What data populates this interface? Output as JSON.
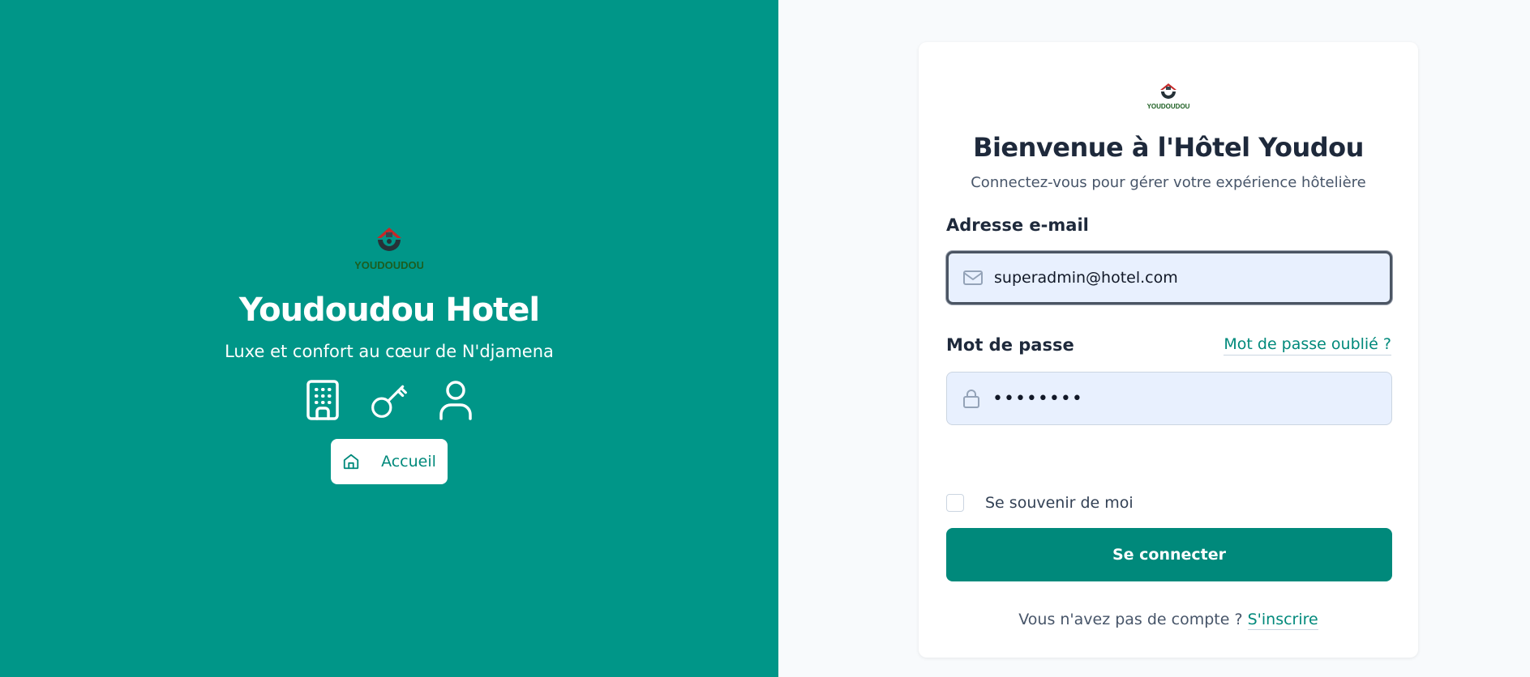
{
  "brand": {
    "logo_text": "YOUDOUDOU",
    "title": "Youdoudou Hotel",
    "tagline": "Luxe et confort au cœur de N'djamena",
    "feature_icons": [
      "building-icon",
      "key-icon",
      "user-icon"
    ],
    "home_button_label": "Accueil"
  },
  "login": {
    "title": "Bienvenue à l'Hôtel Youdou",
    "subtitle": "Connectez-vous pour gérer votre expérience hôtelière",
    "email_label": "Adresse e-mail",
    "email_value": "superadmin@hotel.com",
    "password_label": "Mot de passe",
    "password_value": "••••••••",
    "forgot_label": "Mot de passe oublié ?",
    "remember_label": "Se souvenir de moi",
    "remember_checked": false,
    "submit_label": "Se connecter",
    "signup_prompt": "Vous n'avez pas de compte ? ",
    "signup_link": "S'inscrire"
  },
  "colors": {
    "primary": "#009688",
    "primary_dark": "#00897b",
    "input_bg": "#e8f0fe",
    "page_bg": "#f8fafc",
    "text_dark": "#1e293b"
  }
}
